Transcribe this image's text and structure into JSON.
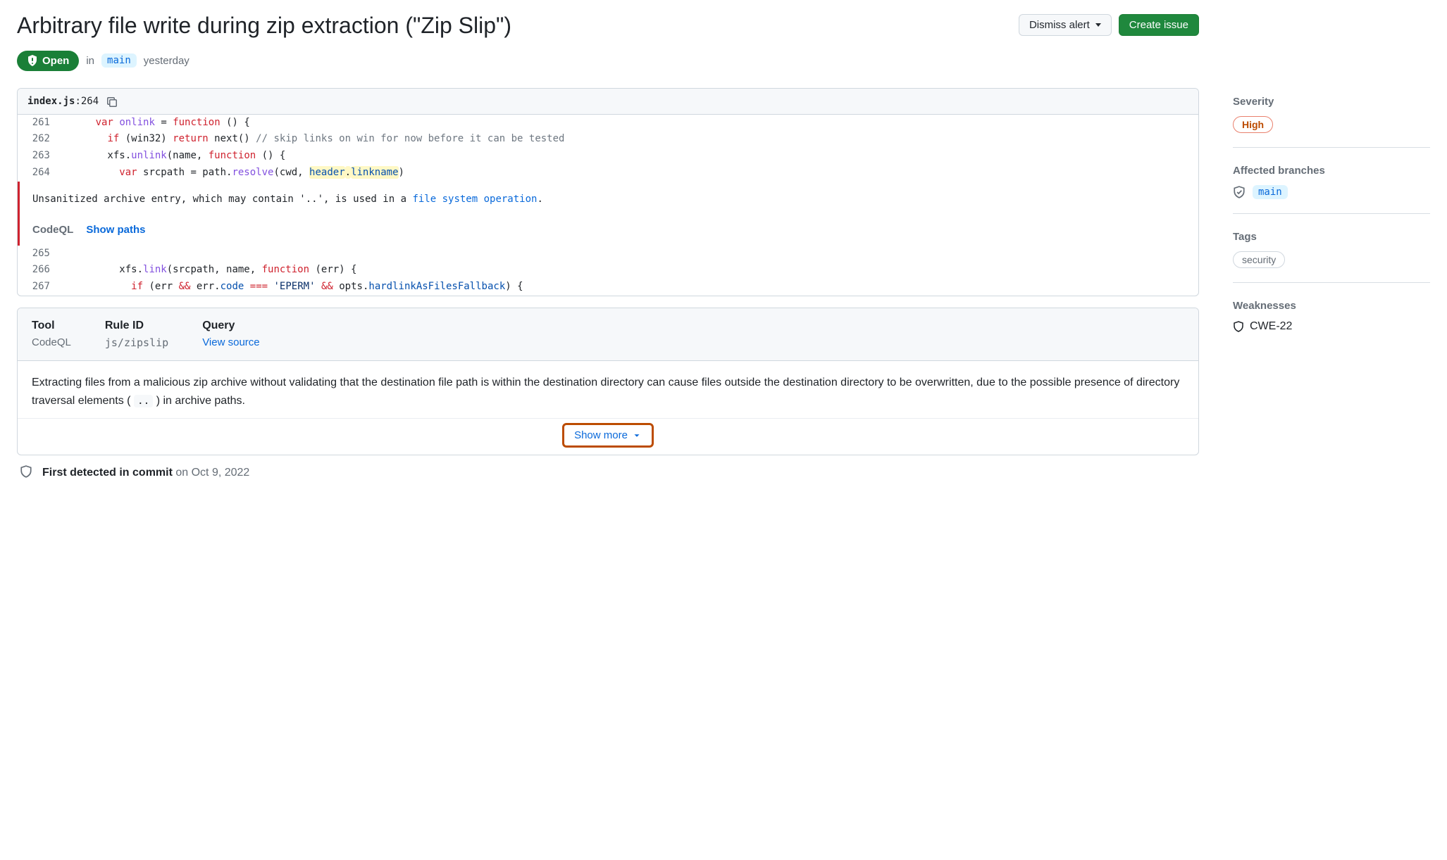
{
  "header": {
    "title": "Arbitrary file write during zip extraction (\"Zip Slip\")",
    "dismiss_label": "Dismiss alert",
    "create_issue_label": "Create issue"
  },
  "status": {
    "state_label": "Open",
    "in_label": "in",
    "branch": "main",
    "time": "yesterday"
  },
  "file": {
    "name": "index.js",
    "line": "264"
  },
  "code": {
    "lines_before": [
      {
        "n": "261",
        "segs": [
          {
            "t": "      ",
            "c": ""
          },
          {
            "t": "var",
            "c": "kw"
          },
          {
            "t": " ",
            "c": ""
          },
          {
            "t": "onlink",
            "c": "fn"
          },
          {
            "t": " = ",
            "c": ""
          },
          {
            "t": "function",
            "c": "kw"
          },
          {
            "t": " () {",
            "c": ""
          }
        ]
      },
      {
        "n": "262",
        "segs": [
          {
            "t": "        ",
            "c": ""
          },
          {
            "t": "if",
            "c": "kw"
          },
          {
            "t": " (win32) ",
            "c": ""
          },
          {
            "t": "return",
            "c": "kw"
          },
          {
            "t": " next() ",
            "c": ""
          },
          {
            "t": "// skip links on win for now before it can be tested",
            "c": "cmt"
          }
        ]
      },
      {
        "n": "263",
        "segs": [
          {
            "t": "        xfs.",
            "c": ""
          },
          {
            "t": "unlink",
            "c": "fn"
          },
          {
            "t": "(name, ",
            "c": ""
          },
          {
            "t": "function",
            "c": "kw"
          },
          {
            "t": " () {",
            "c": ""
          }
        ]
      },
      {
        "n": "264",
        "segs": [
          {
            "t": "          ",
            "c": ""
          },
          {
            "t": "var",
            "c": "kw"
          },
          {
            "t": " srcpath = path.",
            "c": ""
          },
          {
            "t": "resolve",
            "c": "fn"
          },
          {
            "t": "(cwd, ",
            "c": ""
          },
          {
            "t": "header",
            "c": "obj hl"
          },
          {
            "t": ".",
            "c": "hl"
          },
          {
            "t": "linkname",
            "c": "prop hl"
          },
          {
            "t": ")",
            "c": ""
          }
        ]
      }
    ],
    "lines_after": [
      {
        "n": "265",
        "segs": [
          {
            "t": "",
            "c": ""
          }
        ]
      },
      {
        "n": "266",
        "segs": [
          {
            "t": "          xfs.",
            "c": ""
          },
          {
            "t": "link",
            "c": "fn"
          },
          {
            "t": "(srcpath, name, ",
            "c": ""
          },
          {
            "t": "function",
            "c": "kw"
          },
          {
            "t": " (err) {",
            "c": ""
          }
        ]
      },
      {
        "n": "267",
        "segs": [
          {
            "t": "            ",
            "c": ""
          },
          {
            "t": "if",
            "c": "kw"
          },
          {
            "t": " (err ",
            "c": ""
          },
          {
            "t": "&&",
            "c": "kw"
          },
          {
            "t": " err.",
            "c": ""
          },
          {
            "t": "code",
            "c": "prop"
          },
          {
            "t": " ",
            "c": ""
          },
          {
            "t": "===",
            "c": "kw"
          },
          {
            "t": " ",
            "c": ""
          },
          {
            "t": "'EPERM'",
            "c": "str"
          },
          {
            "t": " ",
            "c": ""
          },
          {
            "t": "&&",
            "c": "kw"
          },
          {
            "t": " opts.",
            "c": ""
          },
          {
            "t": "hardlinkAsFilesFallback",
            "c": "prop"
          },
          {
            "t": ") {",
            "c": ""
          }
        ]
      }
    ]
  },
  "note": {
    "msg_pre": "Unsanitized archive entry, which may contain '..', is used in a ",
    "msg_link": "file system operation",
    "msg_post": ".",
    "tool": "CodeQL",
    "show_paths": "Show paths"
  },
  "meta": {
    "tool_label": "Tool",
    "tool_value": "CodeQL",
    "rule_label": "Rule ID",
    "rule_value": "js/zipslip",
    "query_label": "Query",
    "query_value": "View source"
  },
  "description": {
    "text_pre": "Extracting files from a malicious zip archive without validating that the destination file path is within the destination directory can cause files outside the destination directory to be overwritten, due to the possible presence of directory traversal elements ( ",
    "code": "..",
    "text_post": " ) in archive paths."
  },
  "show_more": "Show more",
  "timeline": {
    "bold": "First detected in commit",
    "rest": " on Oct 9, 2022"
  },
  "sidebar": {
    "severity_label": "Severity",
    "severity_value": "High",
    "branches_label": "Affected branches",
    "branches": [
      "main"
    ],
    "tags_label": "Tags",
    "tags": [
      "security"
    ],
    "weaknesses_label": "Weaknesses",
    "weaknesses": [
      "CWE-22"
    ]
  }
}
